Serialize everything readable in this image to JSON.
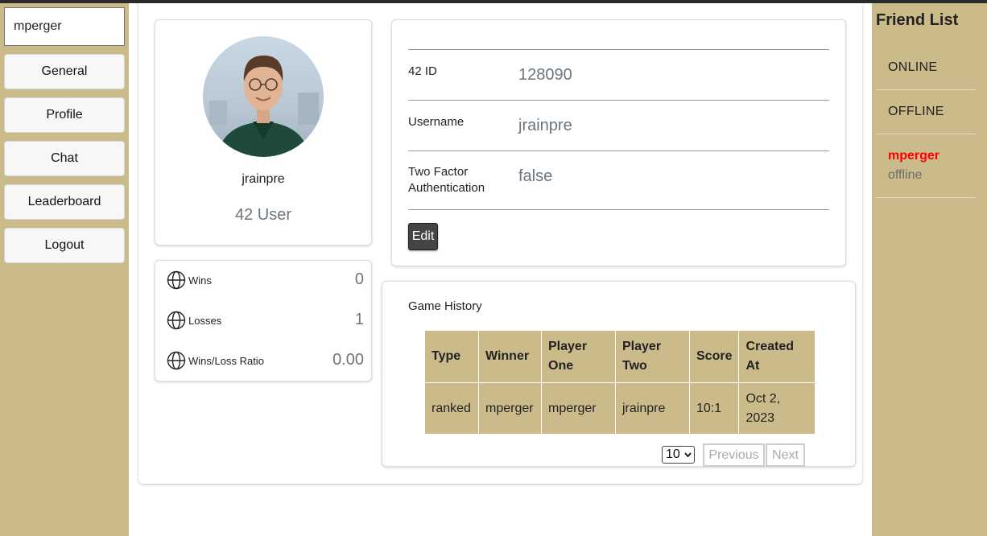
{
  "sidebar": {
    "search_value": "mperger",
    "nav": [
      "General",
      "Profile",
      "Chat",
      "Leaderboard",
      "Logout"
    ]
  },
  "profile": {
    "username": "jrainpre",
    "role": "42 User"
  },
  "stats": [
    {
      "label": "Wins",
      "value": "0"
    },
    {
      "label": "Losses",
      "value": "1"
    },
    {
      "label": "Wins/Loss Ratio",
      "value": "0.00"
    }
  ],
  "info": {
    "rows": [
      {
        "label": "42 ID",
        "value": "128090"
      },
      {
        "label": "Username",
        "value": "jrainpre"
      },
      {
        "label": "Two Factor Authentication",
        "value": "false"
      }
    ],
    "edit_label": "Edit"
  },
  "game_history": {
    "title": "Game History",
    "columns": [
      "Type",
      "Winner",
      "Player One",
      "Player Two",
      "Score",
      "Created At"
    ],
    "rows": [
      [
        "ranked",
        "mperger",
        "mperger",
        "jrainpre",
        "10:1",
        "Oct 2, 2023"
      ]
    ],
    "page_size": "10",
    "prev_label": "Previous",
    "next_label": "Next"
  },
  "friends": {
    "title": "Friend List",
    "sections": [
      "ONLINE",
      "OFFLINE"
    ],
    "list": [
      {
        "name": "mperger",
        "status": "offline"
      }
    ]
  },
  "colors": {
    "accent": "#cbbb8a",
    "friend_name": "#ff0000"
  }
}
